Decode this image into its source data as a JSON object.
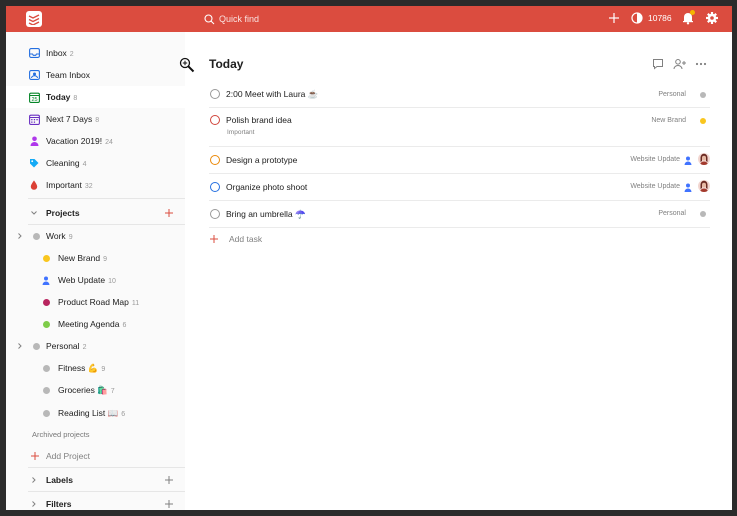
{
  "topbar": {
    "search_placeholder": "Quick find",
    "karma": "10786",
    "colors": {
      "bar": "#db4c3f"
    }
  },
  "sidebar": {
    "filters": [
      {
        "label": "Inbox",
        "count": "2",
        "icon": "inbox-icon"
      },
      {
        "label": "Team Inbox",
        "count": "",
        "icon": "team-inbox-icon"
      },
      {
        "label": "Today",
        "count": "8",
        "icon": "calendar-today-icon"
      },
      {
        "label": "Next 7 Days",
        "count": "8",
        "icon": "calendar-week-icon"
      },
      {
        "label": "Vacation 2019!",
        "count": "24",
        "icon": "person-icon"
      },
      {
        "label": "Cleaning",
        "count": "4",
        "icon": "tag-icon"
      },
      {
        "label": "Important",
        "count": "32",
        "icon": "drop-icon"
      }
    ],
    "projects_label": "Projects",
    "work": {
      "label": "Work",
      "count": "9"
    },
    "work_children": [
      {
        "label": "New Brand",
        "count": "9",
        "color": "#f9c61f"
      },
      {
        "label": "Web Update",
        "count": "10",
        "color": "#4073ff"
      },
      {
        "label": "Product Road Map",
        "count": "11",
        "color": "#b8255f"
      },
      {
        "label": "Meeting Agenda",
        "count": "6",
        "color": "#7ecc49"
      }
    ],
    "personal": {
      "label": "Personal",
      "count": "2"
    },
    "personal_children": [
      {
        "label": "Fitness 💪",
        "count": "9"
      },
      {
        "label": "Groceries 🛍️",
        "count": "7"
      },
      {
        "label": "Reading List 📖",
        "count": "6"
      }
    ],
    "archived_label": "Archived projects",
    "add_project_label": "Add Project",
    "labels_label": "Labels",
    "filters_label": "Filters"
  },
  "main": {
    "title": "Today",
    "tasks": [
      {
        "title": "2:00 Meet with Laura ☕",
        "subtitle": "",
        "project": "Personal",
        "circle_color": "#999999",
        "project_color": "#b8b8b8"
      },
      {
        "title": "Polish brand idea",
        "subtitle": "Important",
        "project": "New Brand",
        "circle_color": "#d1453b",
        "project_color": "#f9c61f"
      },
      {
        "title": "Design a prototype",
        "subtitle": "",
        "project": "Website Update",
        "circle_color": "#eb8909",
        "project_color": "#4073ff"
      },
      {
        "title": "Organize photo shoot",
        "subtitle": "",
        "project": "Website Update",
        "circle_color": "#246fe0",
        "project_color": "#4073ff"
      },
      {
        "title": "Bring an umbrella ☂️",
        "subtitle": "",
        "project": "Personal",
        "circle_color": "#999999",
        "project_color": "#b8b8b8"
      }
    ],
    "add_task_label": "Add task"
  }
}
